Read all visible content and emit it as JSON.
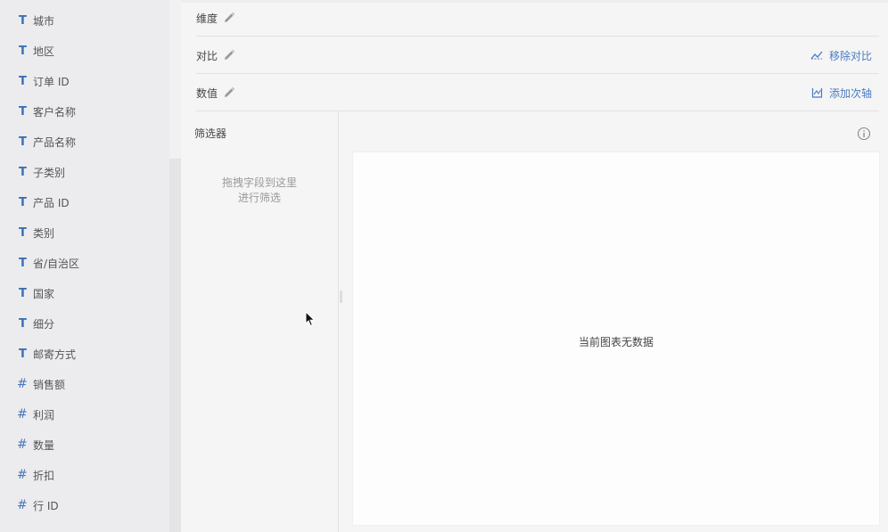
{
  "fields": [
    {
      "type": "T",
      "label": "城市"
    },
    {
      "type": "T",
      "label": "地区"
    },
    {
      "type": "T",
      "label": "订单 ID"
    },
    {
      "type": "T",
      "label": "客户名称"
    },
    {
      "type": "T",
      "label": "产品名称"
    },
    {
      "type": "T",
      "label": "子类别"
    },
    {
      "type": "T",
      "label": "产品 ID"
    },
    {
      "type": "T",
      "label": "类别"
    },
    {
      "type": "T",
      "label": "省/自治区"
    },
    {
      "type": "T",
      "label": "国家"
    },
    {
      "type": "T",
      "label": "细分"
    },
    {
      "type": "T",
      "label": "邮寄方式"
    },
    {
      "type": "#",
      "label": "销售额"
    },
    {
      "type": "#",
      "label": "利润"
    },
    {
      "type": "#",
      "label": "数量"
    },
    {
      "type": "#",
      "label": "折扣"
    },
    {
      "type": "#",
      "label": "行 ID"
    }
  ],
  "shelves": {
    "dimension": {
      "label": "维度"
    },
    "compare": {
      "label": "对比",
      "action": "移除对比"
    },
    "value": {
      "label": "数值",
      "action": "添加次轴"
    }
  },
  "filter": {
    "title": "筛选器",
    "hint_line1": "拖拽字段到这里",
    "hint_line2": "进行筛选"
  },
  "chart": {
    "empty_text": "当前图表无数据"
  },
  "colors": {
    "accent": "#4a7bc2",
    "sidebar_bg": "#ececee",
    "main_bg": "#f5f5f5"
  }
}
